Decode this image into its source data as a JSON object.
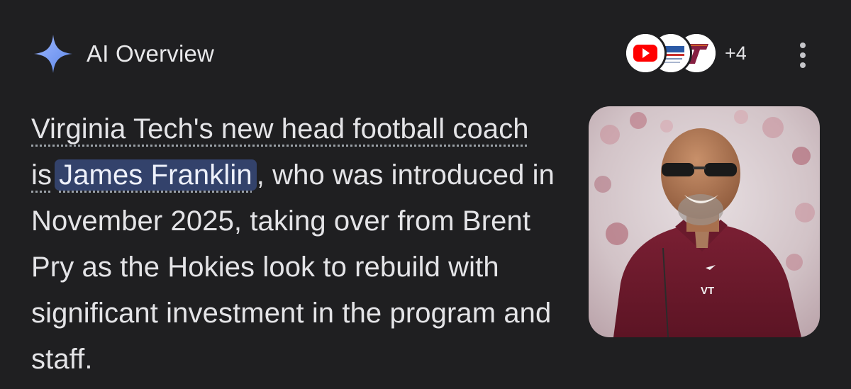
{
  "overview": {
    "title": "AI Overview",
    "icon": "sparkle-icon",
    "sparkle_color": "#7aa2f7"
  },
  "sources": {
    "favicons": [
      {
        "name": "youtube-favicon",
        "color": "#ff0000"
      },
      {
        "name": "news-site-favicon",
        "color": "#2b5aa6"
      },
      {
        "name": "virginia-tech-favicon",
        "color": "#861f41"
      }
    ],
    "more_count": "+4"
  },
  "menu": {
    "icon": "more-vert-icon"
  },
  "summary": {
    "part1": "Virginia Tech's new head football coach is",
    "highlight": "James Franklin",
    "part2": ", who was introduced in November 2025, taking over from Brent Pry as the Hokies look to rebuild with significant investment in the program and staff."
  },
  "image": {
    "logo_text": "VT"
  },
  "colors": {
    "background": "#1f1f21",
    "text": "#e4e4e7",
    "highlight_bg": "#33426b",
    "maroon": "#6b1a2e"
  }
}
